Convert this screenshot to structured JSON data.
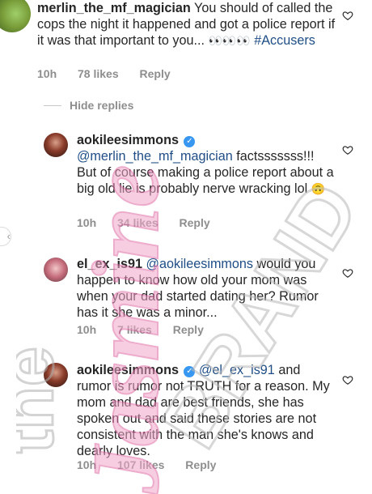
{
  "comments": [
    {
      "username": "merlin_the_mf_magician",
      "text": "You should of called the cops the night it happened and got a police report if it was that important to you...",
      "eyes": "👀👀👀",
      "hashtag": "#Accusers",
      "time": "10h",
      "likes": "78 likes",
      "reply": "Reply"
    },
    {
      "username": "aokileesimmons",
      "mention": "@merlin_the_mf_magician",
      "text": "factsssssss!!! But of course making a police report about a big old lie is probably nerve wracking lol",
      "emoji": "🙃",
      "time": "10h",
      "likes": "34 likes",
      "reply": "Reply"
    },
    {
      "username": "el_ex_is91",
      "mention": "@aokileesimmons",
      "text": "would you happen to know how old your mom was when your dad started dating her? Rumor has it she was a minor...",
      "time": "10h",
      "likes": "7 likes",
      "reply": "Reply"
    },
    {
      "username": "aokileesimmons",
      "mention": "@el_ex_is91",
      "text": "and rumor is rumor not TRUTH for a reason. My mom and dad are best friends, she has spoken out and said these stories are not consistent with the man she's knows and dearly loves.",
      "time": "10h",
      "likes": "107 likes",
      "reply": "Reply"
    }
  ],
  "hide_replies": "Hide replies",
  "watermark": "the Jasmine BRAND",
  "colors": {
    "mention": "#1f4e86",
    "meta": "#8e8e8e",
    "verified": "#3897f0",
    "watermark_pink": "#f2a6c9",
    "watermark_gray": "#cfcfcf"
  },
  "icons": {
    "like": "heart-outline-icon",
    "verified": "verified-badge-icon",
    "nav": "chevron-left-icon"
  }
}
